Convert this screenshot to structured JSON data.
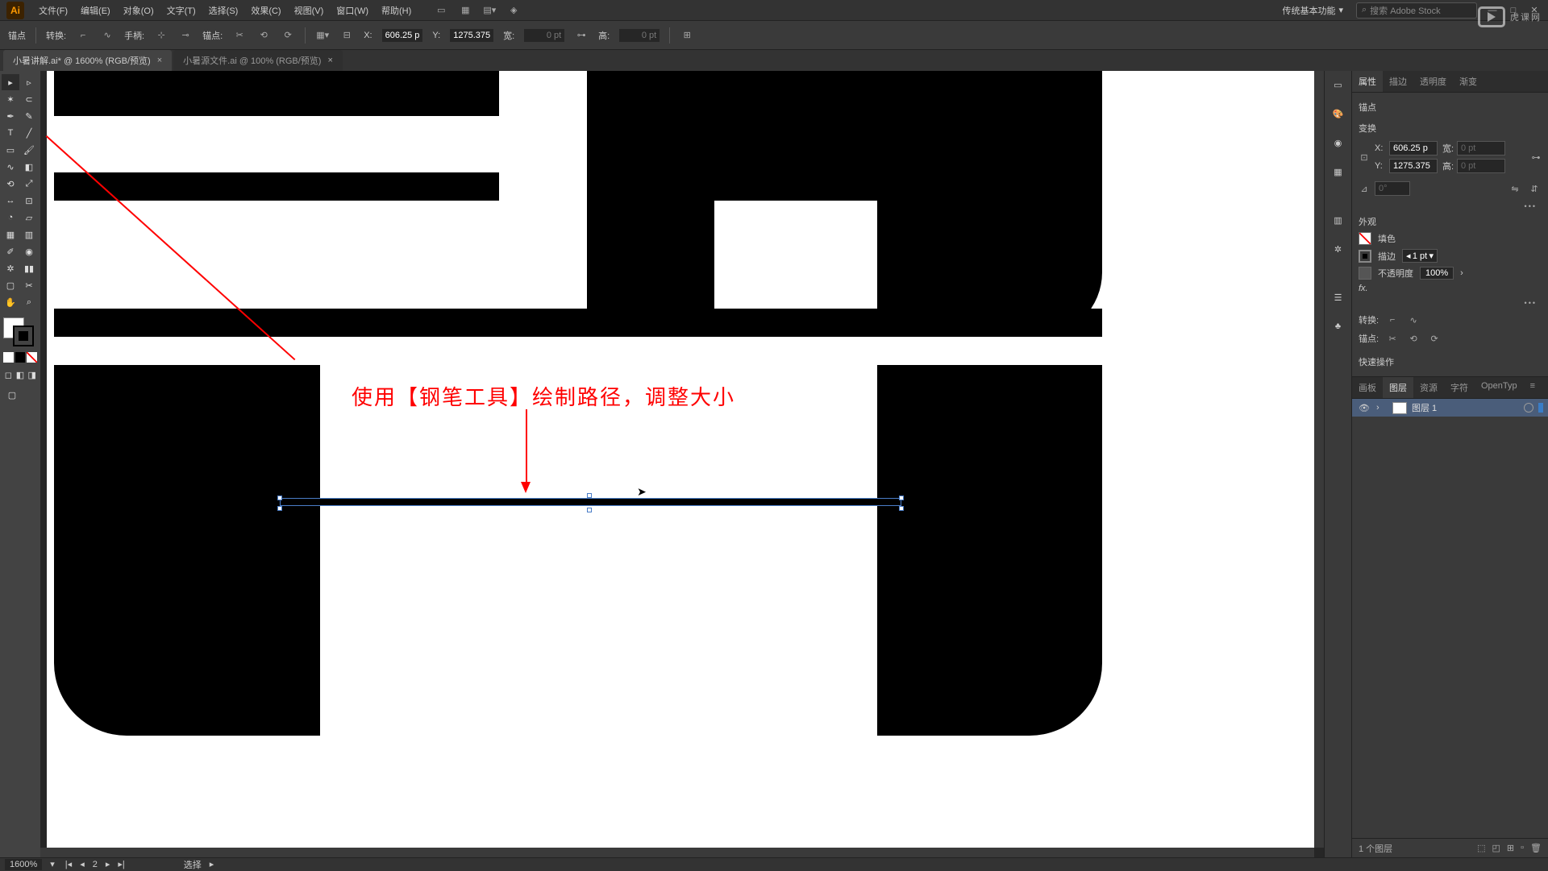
{
  "menu": {
    "file": "文件(F)",
    "edit": "编辑(E)",
    "object": "对象(O)",
    "type": "文字(T)",
    "select": "选择(S)",
    "effect": "效果(C)",
    "view": "视图(V)",
    "window": "窗口(W)",
    "help": "帮助(H)"
  },
  "workspace": "传统基本功能",
  "search_placeholder": "搜索 Adobe Stock",
  "control": {
    "anchor": "锚点",
    "convert": "转换:",
    "handle": "手柄:",
    "anchor_pts": "锚点:",
    "x_label": "X:",
    "x_val": "606.25 p",
    "y_label": "Y:",
    "y_val": "1275.375",
    "w_label": "宽:",
    "w_val": "0 pt",
    "h_label": "高:",
    "h_val": "0 pt"
  },
  "tabs": {
    "active": "小暑讲解.ai* @ 1600% (RGB/预览)",
    "inactive": "小暑源文件.ai @ 100% (RGB/预览)"
  },
  "annotation_text": "使用【钢笔工具】绘制路径，调整大小",
  "props": {
    "tab_props": "属性",
    "tab_stroke": "描边",
    "tab_trans": "透明度",
    "tab_grad": "渐变",
    "anchor_label": "锚点",
    "transform_label": "变换",
    "x": "X:",
    "x_val": "606.25 p",
    "y": "Y:",
    "y_val": "1275.375",
    "w": "宽:",
    "w_val": "0 pt",
    "h": "高:",
    "h_val": "0 pt",
    "angle_val": "0°",
    "appearance": "外观",
    "fill": "填色",
    "stroke": "描边",
    "stroke_val": "1 pt",
    "opacity": "不透明度",
    "opacity_val": "100%",
    "fx": "fx.",
    "convert_label": "转换:",
    "anchor_label2": "锚点:",
    "quick": "快速操作"
  },
  "layers": {
    "tabs": {
      "artboards": "画板",
      "layers": "图层",
      "assets": "资源",
      "glyphs": "字符",
      "opentype": "OpenTyp"
    },
    "layer1": "图层 1",
    "count": "1 个图层"
  },
  "status": {
    "zoom": "1600%",
    "artboard": "2",
    "tool": "选择"
  },
  "watermark": "虎课网"
}
